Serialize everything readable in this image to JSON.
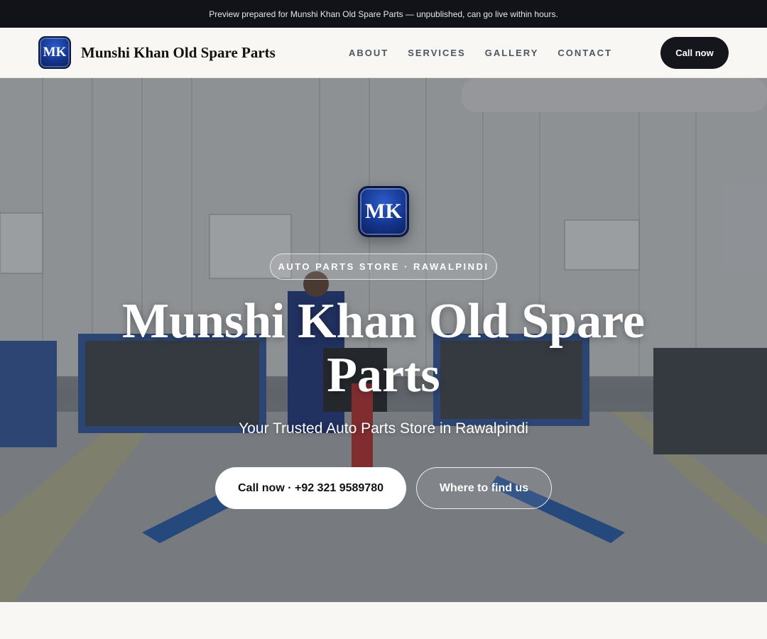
{
  "announcement": "Preview prepared for Munshi Khan Old Spare Parts — unpublished, can go live within hours.",
  "nav": {
    "logo_text": "MK",
    "brand_name": "Munshi Khan Old Spare Parts",
    "links": [
      "ABOUT",
      "SERVICES",
      "GALLERY",
      "CONTACT"
    ],
    "cta_label": "Call now"
  },
  "hero": {
    "logo_text": "MK",
    "eyebrow": "AUTO PARTS STORE · RAWALPINDI",
    "title": "Munshi Khan Old Spare Parts",
    "subtitle": "Your Trusted Auto Parts Store in Rawalpindi",
    "primary_button": "Call now · +92 321 9589780",
    "secondary_button": "Where to find us"
  },
  "colors": {
    "topbar": "#111318",
    "logo_blue": "#13338a",
    "dark_button": "#14161b",
    "page_bg": "#f8f7f4"
  }
}
